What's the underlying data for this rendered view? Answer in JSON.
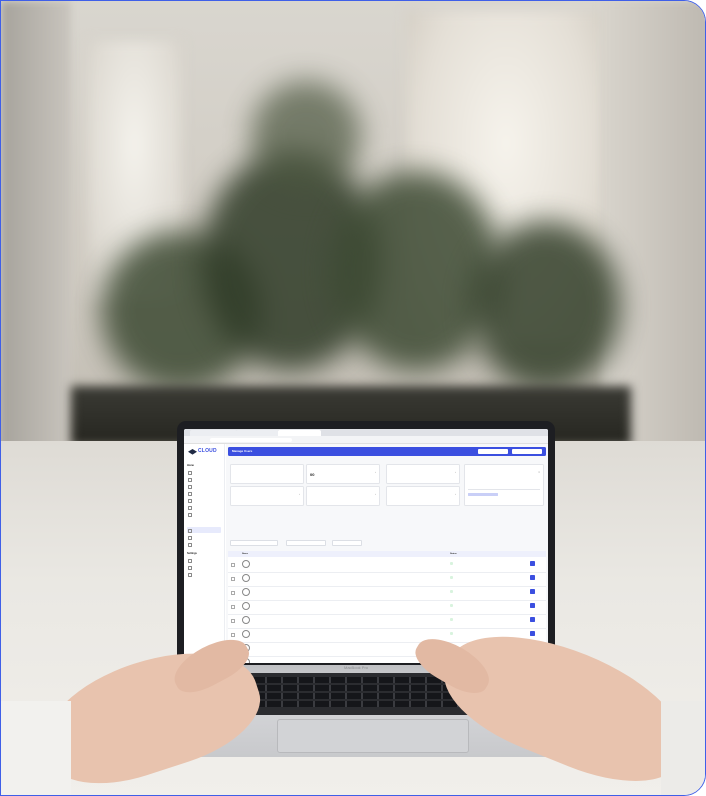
{
  "browser": {
    "tabs": [
      "",
      "",
      ""
    ],
    "address": ""
  },
  "app": {
    "logo_text": "CLOUD",
    "logo_sub": "",
    "header_title": "Manage Users",
    "header_buttons": [
      "",
      ""
    ]
  },
  "sidebar": {
    "sections": [
      {
        "heading": "Home",
        "items": [
          "",
          "",
          "",
          "",
          "",
          "",
          ""
        ]
      },
      {
        "heading": "",
        "items": [
          "",
          "",
          ""
        ]
      },
      {
        "heading": "Settings",
        "items": [
          "",
          "",
          ""
        ]
      }
    ]
  },
  "cards": [
    {
      "label": "",
      "value": ""
    },
    {
      "label": "",
      "value": "00"
    },
    {
      "label": "",
      "value": ""
    },
    {
      "label": "",
      "value": ""
    },
    {
      "label": "",
      "value": ""
    },
    {
      "label": "",
      "value": ""
    },
    {
      "label": "",
      "value": ""
    }
  ],
  "filters": [
    "",
    "",
    ""
  ],
  "table": {
    "columns": [
      "Name",
      "",
      "",
      "",
      "Status"
    ],
    "rows": [
      {
        "name": "",
        "sub": "",
        "type": "",
        "a": "",
        "b": "",
        "status": ""
      },
      {
        "name": "",
        "sub": "",
        "type": "",
        "a": "",
        "b": "",
        "status": ""
      },
      {
        "name": "",
        "sub": "",
        "type": "",
        "a": "",
        "b": "",
        "status": ""
      },
      {
        "name": "",
        "sub": "",
        "type": "",
        "a": "",
        "b": "",
        "status": ""
      },
      {
        "name": "",
        "sub": "",
        "type": "",
        "a": "",
        "b": "",
        "status": ""
      },
      {
        "name": "",
        "sub": "",
        "type": "",
        "a": "",
        "b": "",
        "status": ""
      },
      {
        "name": "",
        "sub": "",
        "type": "",
        "a": "",
        "b": "",
        "status": ""
      },
      {
        "name": "",
        "sub": "",
        "type": "",
        "a": "",
        "b": "",
        "status": ""
      }
    ]
  },
  "laptop": {
    "model_text": "MacBook Pro"
  },
  "colors": {
    "accent": "#3b4fe0",
    "frame_border": "#3f5fe8",
    "status_bg": "#d8f3de",
    "status_fg": "#1f8a3a"
  }
}
